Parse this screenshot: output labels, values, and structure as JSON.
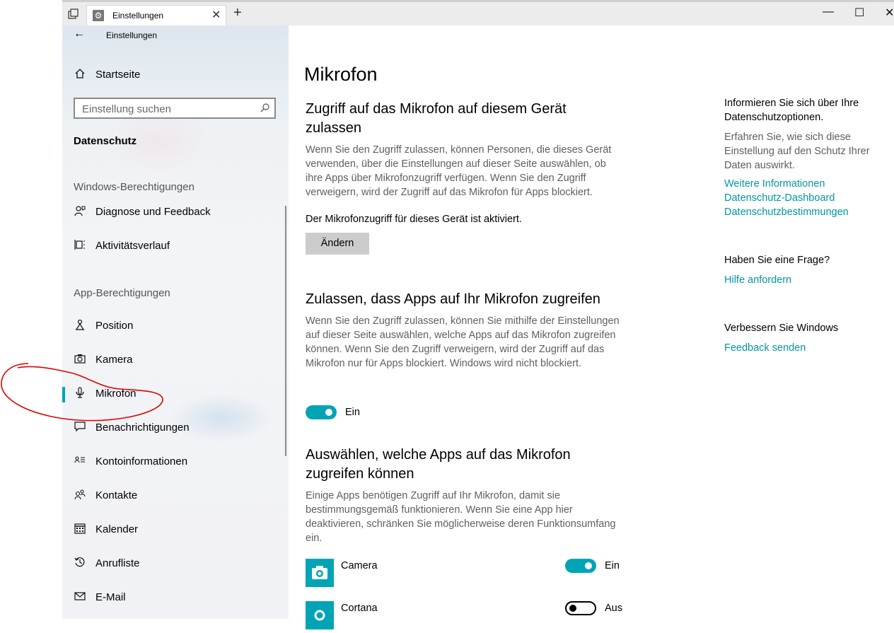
{
  "window": {
    "tab_title": "Einstellungen",
    "tab_close": "✕",
    "new_tab": "+",
    "minimize": "—",
    "maximize": "☐",
    "close": "✕"
  },
  "sidebar": {
    "app_title": "Einstellungen",
    "home": "Startseite",
    "search_placeholder": "Einstellung suchen",
    "group": "Datenschutz",
    "section_windows": "Windows-Berechtigungen",
    "windows_items": [
      {
        "label": "Diagnose und Feedback",
        "icon": "diagnostics-icon"
      },
      {
        "label": "Aktivitätsverlauf",
        "icon": "activity-history-icon"
      }
    ],
    "section_apps": "App-Berechtigungen",
    "app_items": [
      {
        "label": "Position",
        "icon": "location-icon"
      },
      {
        "label": "Kamera",
        "icon": "camera-icon"
      },
      {
        "label": "Mikrofon",
        "icon": "microphone-icon",
        "selected": true
      },
      {
        "label": "Benachrichtigungen",
        "icon": "notifications-icon"
      },
      {
        "label": "Kontoinformationen",
        "icon": "account-info-icon"
      },
      {
        "label": "Kontakte",
        "icon": "contacts-icon"
      },
      {
        "label": "Kalender",
        "icon": "calendar-icon"
      },
      {
        "label": "Anrufliste",
        "icon": "call-history-icon"
      },
      {
        "label": "E-Mail",
        "icon": "email-icon"
      }
    ]
  },
  "main": {
    "title": "Mikrofon",
    "device_section": {
      "heading": "Zugriff auf das Mikrofon auf diesem Gerät zulassen",
      "description": "Wenn Sie den Zugriff zulassen, können Personen, die dieses Gerät verwenden, über die Einstellungen auf dieser Seite auswählen, ob ihre Apps über Mikrofonzugriff verfügen. Wenn Sie den Zugriff verweigern, wird der Zugriff auf das Mikrofon für Apps blockiert.",
      "status": "Der Mikrofonzugriff für dieses Gerät ist aktiviert.",
      "change_button": "Ändern"
    },
    "apps_section": {
      "heading": "Zulassen, dass Apps auf Ihr Mikrofon zugreifen",
      "description": "Wenn Sie den Zugriff zulassen, können Sie mithilfe der Einstellungen auf dieser Seite auswählen, welche Apps auf das Mikrofon zugreifen können. Wenn Sie den Zugriff verweigern, wird der Zugriff auf das Mikrofon nur für Apps blockiert. Windows wird nicht blockiert.",
      "toggle_label": "Ein",
      "toggle_on": true
    },
    "choose_section": {
      "heading": "Auswählen, welche Apps auf das Mikrofon zugreifen können",
      "description": "Einige Apps benötigen Zugriff auf Ihr Mikrofon, damit sie bestimmungsgemäß funktionieren. Wenn Sie eine App hier deaktivieren, schränken Sie möglicherweise deren Funktionsumfang ein.",
      "apps": [
        {
          "name": "Camera",
          "state_label": "Ein",
          "on": true
        },
        {
          "name": "Cortana",
          "state_label": "Aus",
          "on": false
        }
      ]
    }
  },
  "right": {
    "privacy_heading": "Informieren Sie sich über Ihre Datenschutzoptionen.",
    "privacy_text": "Erfahren Sie, wie sich diese Einstellung auf den Schutz Ihrer Daten auswirkt.",
    "links": [
      "Weitere Informationen",
      "Datenschutz-Dashboard",
      "Datenschutzbestimmungen"
    ],
    "question_heading": "Haben Sie eine Frage?",
    "question_link": "Hilfe anfordern",
    "improve_heading": "Verbessern Sie Windows",
    "improve_link": "Feedback senden"
  },
  "colors": {
    "accent": "#00a5b5",
    "link": "#0095a8",
    "annotation": "#e00000"
  }
}
